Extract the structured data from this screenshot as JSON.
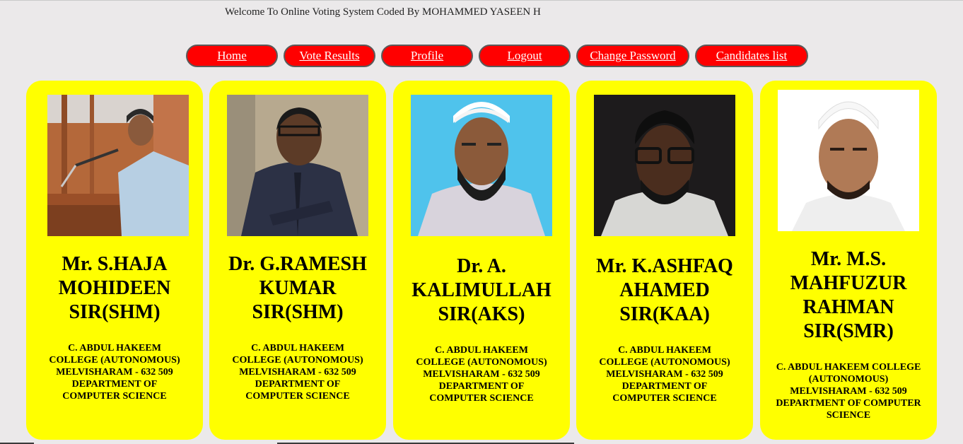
{
  "header": {
    "welcome": "Welcome To Online Voting System Coded By MOHAMMED YASEEN H"
  },
  "nav": {
    "home": "Home",
    "vote_results": "Vote Results",
    "profile": "Profile",
    "logout": "Logout",
    "change_password": "Change Password",
    "candidates_list": "Candidates list"
  },
  "candidates": [
    {
      "name": "Mr. S.HAJA MOHIDEEN SIR(SHM)",
      "college": "C. ABDUL HAKEEM COLLEGE (AUTONOMOUS)",
      "location": "MELVISHARAM - 632 509",
      "department": "DEPARTMENT OF COMPUTER SCIENCE"
    },
    {
      "name": "Dr. G.RAMESH KUMAR SIR(SHM)",
      "college": "C. ABDUL HAKEEM COLLEGE (AUTONOMOUS)",
      "location": "MELVISHARAM - 632 509",
      "department": "DEPARTMENT OF COMPUTER SCIENCE"
    },
    {
      "name": "Dr. A. KALIMULLAH SIR(AKS)",
      "college": "C. ABDUL HAKEEM COLLEGE (AUTONOMOUS)",
      "location": "MELVISHARAM - 632 509",
      "department": "DEPARTMENT OF COMPUTER SCIENCE"
    },
    {
      "name": "Mr. K.ASHFAQ AHAMED SIR(KAA)",
      "college": "C. ABDUL HAKEEM COLLEGE (AUTONOMOUS)",
      "location": "MELVISHARAM - 632 509",
      "department": "DEPARTMENT OF COMPUTER SCIENCE"
    },
    {
      "name": "Mr. M.S. MAHFUZUR RAHMAN SIR(SMR)",
      "college": "C. ABDUL HAKEEM COLLEGE (AUTONOMOUS)",
      "location": "MELVISHARAM - 632 509",
      "department": "DEPARTMENT OF COMPUTER SCIENCE"
    }
  ],
  "colors": {
    "page_bg": "#ebe9ea",
    "button_bg": "#ff0000",
    "card_bg": "#ffff00"
  }
}
